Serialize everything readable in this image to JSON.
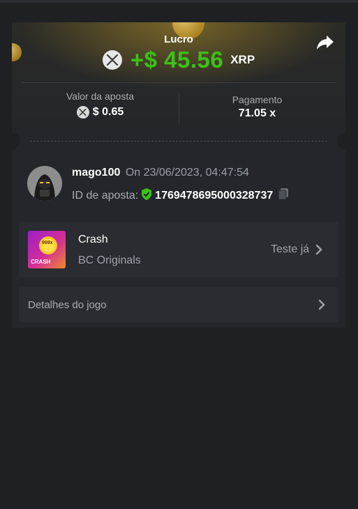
{
  "header": {
    "title": "Lucro",
    "profit": "+$ 45.56",
    "currency": "XRP",
    "share_icon": "share-icon",
    "coin_icon": "xrp-icon"
  },
  "stats": {
    "bet_label": "Valor da aposta",
    "bet_value": "$ 0.65",
    "payout_label": "Pagamento",
    "payout_value": "71.05 x"
  },
  "user": {
    "username": "mago100",
    "date": "On 23/06/2023, 04:47:54",
    "bet_id_label": "ID de aposta:",
    "bet_id": "1769478695000328737",
    "avatar_icon": "avatar"
  },
  "game": {
    "name": "Crash",
    "provider": "BC Originals",
    "try_label": "Teste já",
    "thumb_label": "CRASH",
    "thumb_badge": "999x"
  },
  "details": {
    "label": "Detalhes do jogo"
  },
  "colors": {
    "accent_green": "#3bc117",
    "background": "#1e2024",
    "card": "#24262b",
    "row": "#2a2c31"
  }
}
